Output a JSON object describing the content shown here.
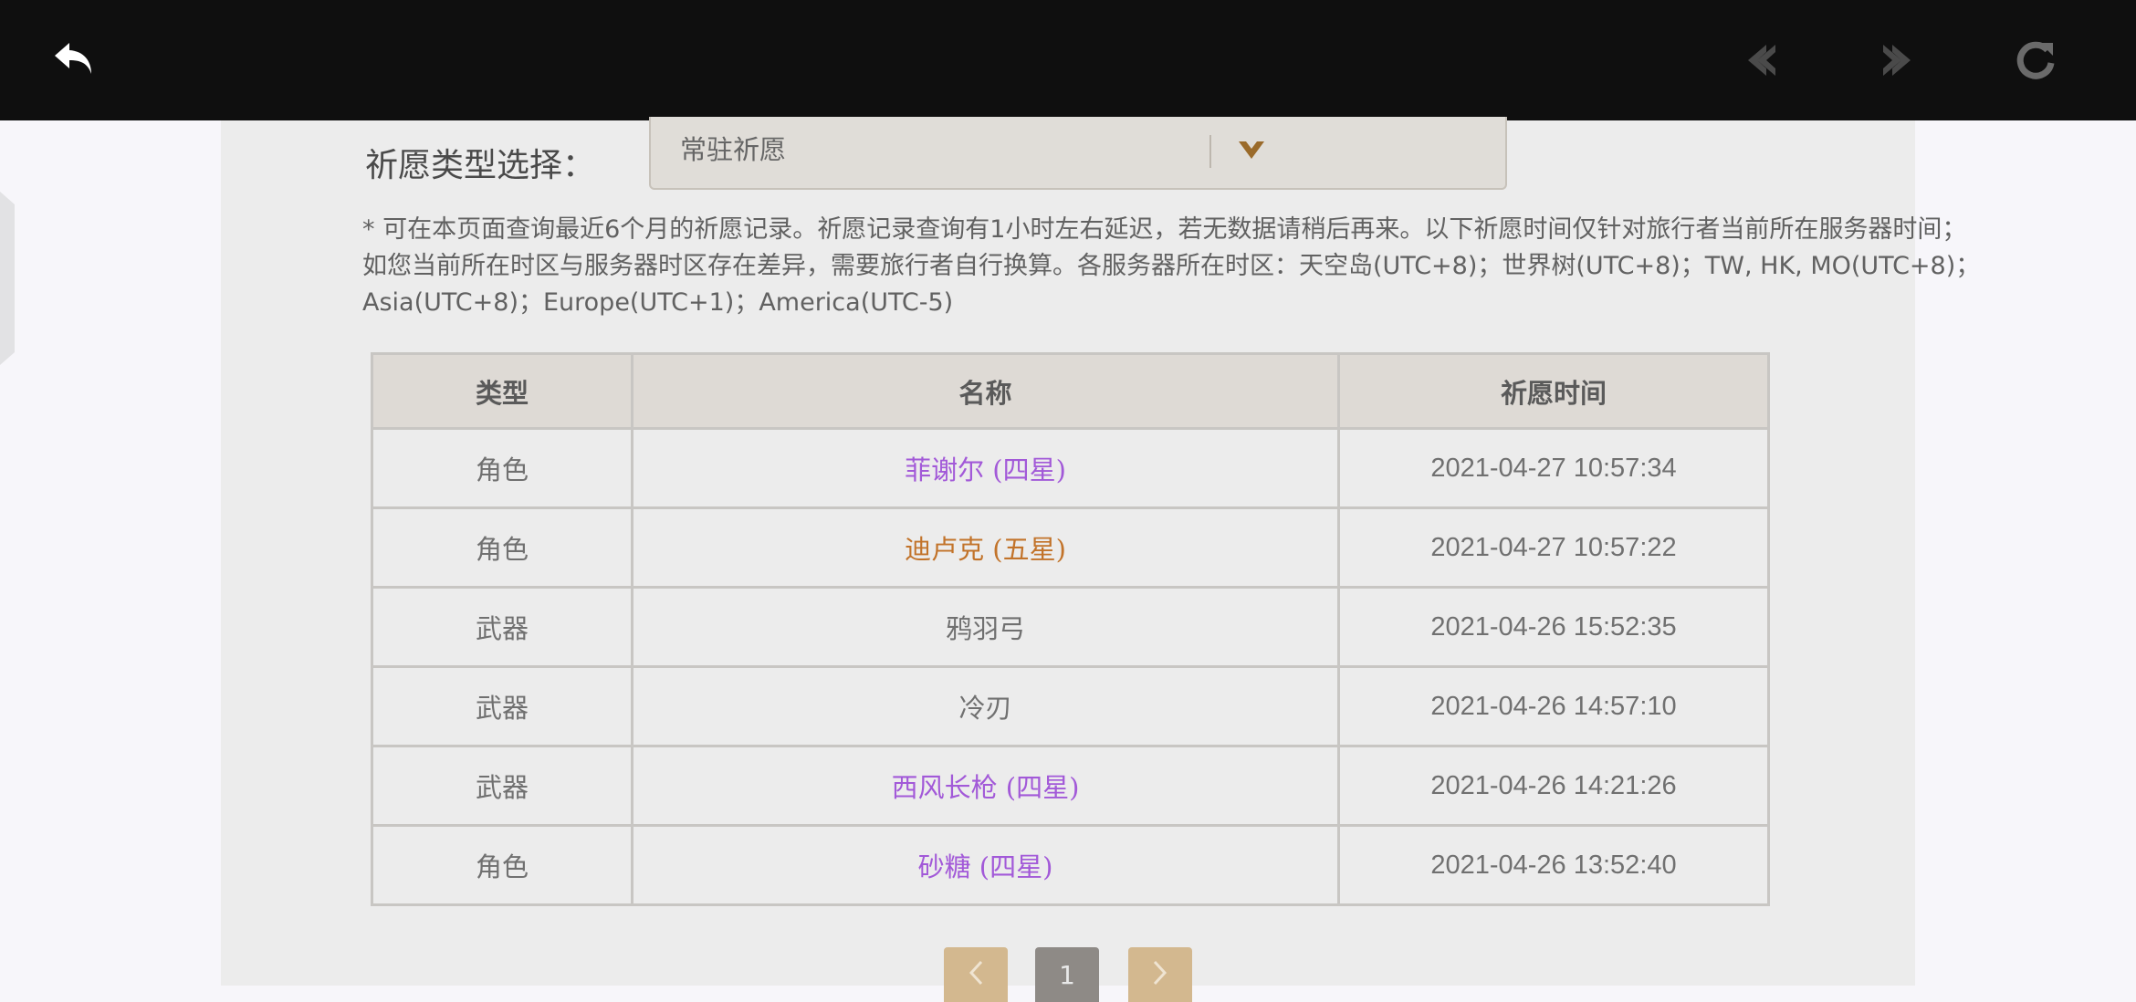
{
  "colors": {
    "four_star": "#a259d8",
    "five_star": "#c2732a",
    "three_star": "#707070"
  },
  "topbar": {
    "back_icon": "back-arrow-icon",
    "nav_back_icon": "nav-back-icon",
    "nav_forward_icon": "nav-forward-icon",
    "refresh_icon": "refresh-icon"
  },
  "filter": {
    "label": "祈愿类型选择：",
    "selected": "常驻祈愿"
  },
  "notice": "* 可在本页面查询最近6个月的祈愿记录。祈愿记录查询有1小时左右延迟，若无数据请稍后再来。以下祈愿时间仅针对旅行者当前所在服务器时间；如您当前所在时区与服务器时区存在差异，需要旅行者自行换算。各服务器所在时区：天空岛(UTC+8)；世界树(UTC+8)；TW, HK, MO(UTC+8)；Asia(UTC+8)；Europe(UTC+1)；America(UTC-5)",
  "table": {
    "headers": [
      "类型",
      "名称",
      "祈愿时间"
    ],
    "rows": [
      {
        "type": "角色",
        "name": "菲谢尔 (四星)",
        "time": "2021-04-27 10:57:34",
        "rarity": "four_star"
      },
      {
        "type": "角色",
        "name": "迪卢克 (五星)",
        "time": "2021-04-27 10:57:22",
        "rarity": "five_star"
      },
      {
        "type": "武器",
        "name": "鸦羽弓",
        "time": "2021-04-26 15:52:35",
        "rarity": "three_star"
      },
      {
        "type": "武器",
        "name": "冷刃",
        "time": "2021-04-26 14:57:10",
        "rarity": "three_star"
      },
      {
        "type": "武器",
        "name": "西风长枪 (四星)",
        "time": "2021-04-26 14:21:26",
        "rarity": "four_star"
      },
      {
        "type": "角色",
        "name": "砂糖 (四星)",
        "time": "2021-04-26 13:52:40",
        "rarity": "four_star"
      }
    ]
  },
  "pagination": {
    "current_page": "1",
    "prev_icon": "chevron-left-icon",
    "next_icon": "chevron-right-icon"
  }
}
